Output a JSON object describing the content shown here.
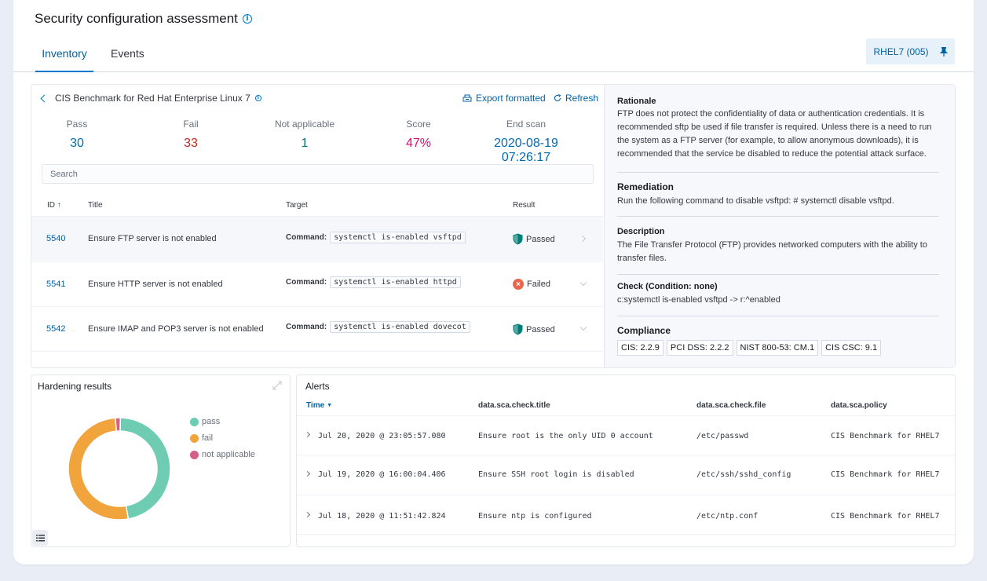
{
  "page_title": "Security configuration assessment",
  "tabs": [
    {
      "label": "Inventory"
    },
    {
      "label": "Events"
    }
  ],
  "agent_button": "RHEL7 (005)",
  "benchmark": {
    "title": "CIS Benchmark for Red Hat Enterprise Linux 7",
    "export_label": "Export formatted",
    "refresh_label": "Refresh"
  },
  "stats": [
    {
      "label": "Pass",
      "value": "30",
      "color": "#006bb4"
    },
    {
      "label": "Fail",
      "value": "33",
      "color": "#bd271e"
    },
    {
      "label": "Not applicable",
      "value": "1",
      "color": "#017d73"
    },
    {
      "label": "Score",
      "value": "47%",
      "color": "#dd0a73"
    },
    {
      "label": "End scan",
      "value": "2020-08-19 07:26:17",
      "color": "#006bb4"
    }
  ],
  "search_placeholder": "Search",
  "table": {
    "headers": {
      "id": "ID ↑",
      "title": "Title",
      "target": "Target",
      "result": "Result"
    },
    "cmd_label": "Command:",
    "rows": [
      {
        "id": "5540",
        "title": "Ensure FTP server is not enabled",
        "command": "systemctl is-enabled vsftpd",
        "result": "Passed"
      },
      {
        "id": "5541",
        "title": "Ensure HTTP server is not enabled",
        "command": "systemctl is-enabled httpd",
        "result": "Failed"
      },
      {
        "id": "5542",
        "title": "Ensure IMAP and POP3 server is not enabled",
        "command": "systemctl is-enabled dovecot",
        "result": "Passed"
      }
    ]
  },
  "details": {
    "rationale_title": "Rationale",
    "rationale_text": "FTP does not protect the confidentiality of data or authentication credentials. It is recommended sftp be used if file transfer is required. Unless there is a need to run the system as a FTP server (for example, to allow anonymous downloads), it is recommended that the service be disabled to reduce the potential attack surface.",
    "remediation_title": "Remediation",
    "remediation_text": "Run the following command to disable vsftpd: # systemctl disable vsftpd.",
    "description_title": "Description",
    "description_text": "The File Transfer Protocol (FTP) provides networked computers with the ability to transfer files.",
    "check_title": "Check (Condition: none)",
    "check_text": "c:systemctl is-enabled vsftpd -> r:^enabled",
    "compliance_title": "Compliance",
    "compliance": [
      "CIS: 2.2.9",
      "PCI DSS: 2.2.2",
      "NIST 800-53: CM.1",
      "CIS CSC: 9.1"
    ]
  },
  "hardening": {
    "title": "Hardening results",
    "legend": [
      "pass",
      "fail",
      "not applicable"
    ]
  },
  "chart_data": {
    "type": "pie",
    "categories": [
      "pass",
      "fail",
      "not applicable"
    ],
    "values": [
      30,
      33,
      1
    ],
    "colors": [
      "#6dccb1",
      "#f1a43c",
      "#d36086"
    ],
    "donut": true,
    "legend": "right"
  },
  "alerts": {
    "title": "Alerts",
    "headers": [
      "Time",
      "data.sca.check.title",
      "data.sca.check.file",
      "data.sca.policy"
    ],
    "rows": [
      {
        "time": "Jul 20, 2020 @ 23:05:57.080",
        "title": "Ensure root is the only UID 0 account",
        "file": "/etc/passwd",
        "policy": "CIS Benchmark for RHEL7"
      },
      {
        "time": "Jul 19, 2020 @ 16:00:04.406",
        "title": "Ensure SSH root login is disabled",
        "file": "/etc/ssh/sshd_config",
        "policy": "CIS Benchmark for RHEL7"
      },
      {
        "time": "Jul 18, 2020 @ 11:51:42.824",
        "title": "Ensure ntp is configured",
        "file": "/etc/ntp.conf",
        "policy": "CIS Benchmark for RHEL7"
      }
    ]
  }
}
